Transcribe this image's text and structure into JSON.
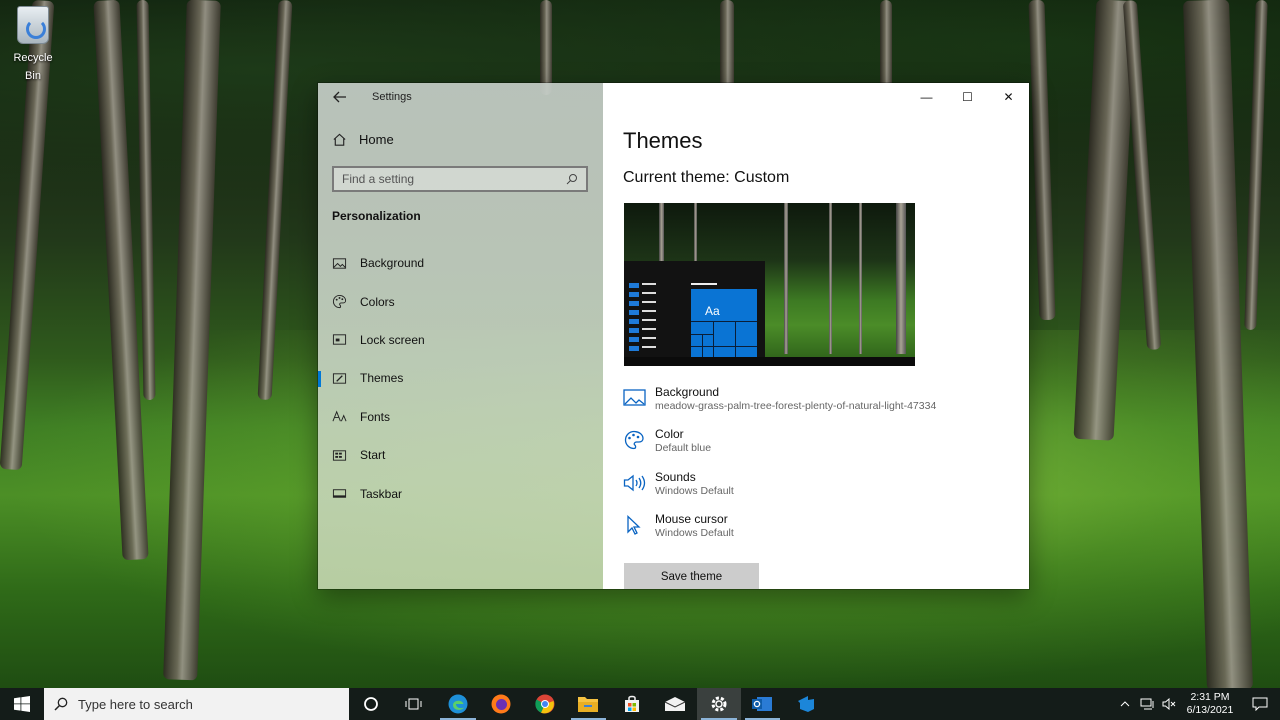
{
  "desktop": {
    "recycle_bin_label": "Recycle Bin"
  },
  "settings": {
    "app_title": "Settings",
    "home_label": "Home",
    "search_placeholder": "Find a setting",
    "section_title": "Personalization",
    "nav_items": [
      {
        "label": "Background",
        "icon": "picture-icon"
      },
      {
        "label": "Colors",
        "icon": "palette-icon"
      },
      {
        "label": "Lock screen",
        "icon": "lock-screen-icon"
      },
      {
        "label": "Themes",
        "icon": "brush-icon",
        "active": true
      },
      {
        "label": "Fonts",
        "icon": "font-icon"
      },
      {
        "label": "Start",
        "icon": "start-icon"
      },
      {
        "label": "Taskbar",
        "icon": "taskbar-icon"
      }
    ],
    "window_controls": {
      "minimize": "—",
      "maximize": "☐",
      "close": "✕"
    }
  },
  "themes_page": {
    "title": "Themes",
    "current_theme": "Current theme: Custom",
    "preview_tile_text": "Aa",
    "properties": [
      {
        "title": "Background",
        "subtitle": "meadow-grass-palm-tree-forest-plenty-of-natural-light-47334",
        "icon": "picture-icon"
      },
      {
        "title": "Color",
        "subtitle": "Default blue",
        "icon": "palette-icon"
      },
      {
        "title": "Sounds",
        "subtitle": "Windows Default",
        "icon": "speaker-icon"
      },
      {
        "title": "Mouse cursor",
        "subtitle": "Windows Default",
        "icon": "cursor-icon"
      }
    ],
    "save_button": "Save theme"
  },
  "taskbar": {
    "search_placeholder": "Type here to search",
    "time": "2:31 PM",
    "date": "6/13/2021",
    "apps": [
      "cortana-icon",
      "task-view-icon",
      "edge-icon",
      "firefox-icon",
      "chrome-icon",
      "file-explorer-icon",
      "store-icon",
      "mail-icon",
      "settings-icon",
      "outlook-icon",
      "azure-devops-icon"
    ],
    "accent_color": "#0078d7"
  }
}
